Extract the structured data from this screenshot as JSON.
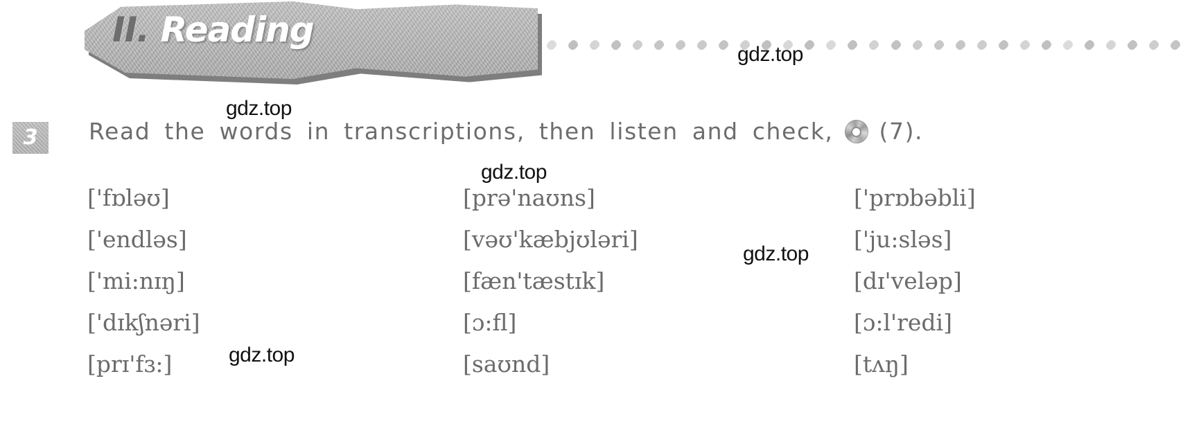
{
  "banner": {
    "number": "II.",
    "title": "Reading"
  },
  "divider": {
    "icon": "dotted-rule-icon",
    "dot_count": 30,
    "color": "#bfbfbf"
  },
  "exercise": {
    "number": "3",
    "instruction_before_icon": "Read the words in transcriptions, then listen and check,",
    "media_icon": "cd-disc-icon",
    "track_reference": "(7)."
  },
  "columns": [
    {
      "name": "column-1",
      "items": [
        "['fɒləʊ]",
        "['endləs]",
        "['mi:nɪŋ]",
        "['dɪkʃnəri]",
        "[prɪ'fɜ:]"
      ]
    },
    {
      "name": "column-2",
      "items": [
        "[prə'naʊns]",
        "[vəʊ'kæbjʊləri]",
        "[fæn'tæstɪk]",
        "[ɔ:fl]",
        "[saʊnd]"
      ]
    },
    {
      "name": "column-3",
      "items": [
        "['prɒbəbli]",
        "['ju:sləs]",
        "[dɪ'veləp]",
        "[ɔ:l'redi]",
        "[tʌŋ]"
      ]
    }
  ],
  "watermarks": [
    "gdz.top",
    "gdz.top",
    "gdz.top",
    "gdz.top",
    "gdz.top"
  ],
  "colors": {
    "banner_fill": "#b6b6b6",
    "banner_shadow": "#7e7e7e",
    "text_gray": "#6b6b6b",
    "number_box": "#b4b4b4",
    "page_background": "#ffffff"
  }
}
